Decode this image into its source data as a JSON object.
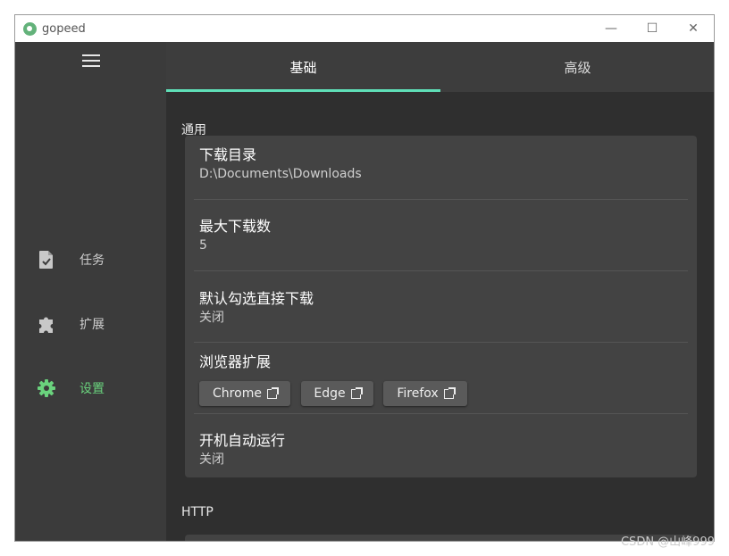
{
  "window": {
    "title": "gopeed"
  },
  "window_controls": {
    "minimize": "—",
    "maximize": "☐",
    "close": "✕"
  },
  "sidebar": {
    "items": [
      {
        "label": "任务",
        "icon": "task-file-icon"
      },
      {
        "label": "扩展",
        "icon": "puzzle-icon"
      },
      {
        "label": "设置",
        "icon": "gear-icon",
        "active": true
      }
    ]
  },
  "tabs": [
    {
      "label": "基础",
      "active": true
    },
    {
      "label": "高级",
      "active": false
    }
  ],
  "sections": {
    "general": {
      "title": "通用",
      "rows": [
        {
          "title": "下载目录",
          "value": "D:\\Documents\\Downloads"
        },
        {
          "title": "最大下载数",
          "value": "5"
        },
        {
          "title": "默认勾选直接下载",
          "value": "关闭"
        },
        {
          "title": "浏览器扩展",
          "buttons": [
            "Chrome",
            "Edge",
            "Firefox"
          ]
        },
        {
          "title": "开机自动运行",
          "value": "关闭"
        }
      ]
    },
    "http": {
      "title": "HTTP"
    }
  },
  "watermark": "CSDN @山峰999",
  "colors": {
    "accent": "#5fe0b8",
    "active_nav": "#6ad27d",
    "background": "#2f2f2f",
    "card": "#434343"
  }
}
